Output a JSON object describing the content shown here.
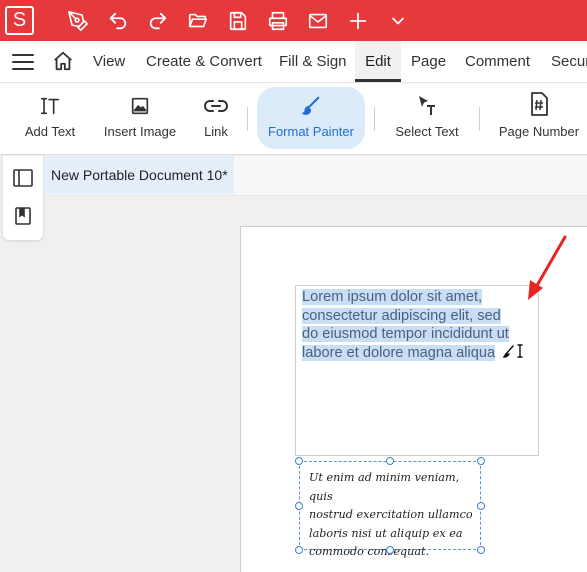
{
  "app": {
    "logo_letter": "S",
    "accent_color": "#e5393b",
    "quick_access": [
      "pen-icon",
      "undo-icon",
      "redo-icon",
      "open-folder-icon",
      "save-icon",
      "print-icon",
      "mail-icon",
      "plus-icon",
      "chevron-down-icon"
    ]
  },
  "menu": {
    "hamburger_icon": "hamburger-icon",
    "home_icon": "home-icon",
    "tabs": [
      "View",
      "Create & Convert",
      "Fill & Sign",
      "Edit",
      "Page",
      "Comment",
      "Secur"
    ],
    "active_tab": "Edit"
  },
  "ribbon": {
    "tools": [
      {
        "label": "Add Text",
        "icon": "add-text-icon"
      },
      {
        "label": "Insert Image",
        "icon": "image-icon"
      },
      {
        "label": "Link",
        "icon": "link-icon"
      },
      {
        "label": "Format Painter",
        "icon": "paintbrush-icon",
        "active": true
      },
      {
        "label": "Select Text",
        "icon": "select-text-icon"
      },
      {
        "label": "Page Number",
        "icon": "page-number-icon"
      }
    ]
  },
  "document": {
    "tab_title": "New Portable Document 10*",
    "text_block_1": {
      "lines": [
        "Lorem ipsum dolor sit amet,",
        "consectetur adipiscing elit, sed",
        "do eiusmod tempor incididunt ut",
        "labore et dolore magna aliqua"
      ]
    },
    "text_block_2": {
      "lines": [
        "Ut enim ad minim veniam, quis",
        "nostrud exercitation ullamco",
        "laboris nisi ut aliquip ex ea",
        "commodo consequat."
      ]
    }
  },
  "colors": {
    "highlight": "#c9def3",
    "active_tool_bg": "#dcebfa",
    "active_tool_text": "#1f6fd0",
    "annotation_arrow": "#e8241f"
  }
}
